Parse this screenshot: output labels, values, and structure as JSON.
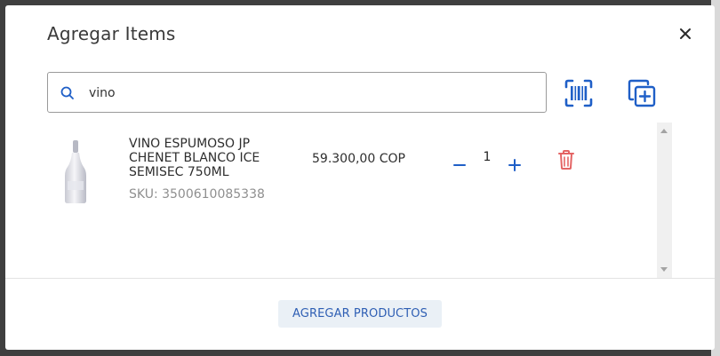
{
  "modal": {
    "title": "Agregar Items",
    "close_icon": "close-icon"
  },
  "search": {
    "value": "vino",
    "icon": "search-icon"
  },
  "toolbar": {
    "barcode_icon": "barcode-scan-icon",
    "add_copy_icon": "add-copy-icon"
  },
  "colors": {
    "accent": "#1f5fc7",
    "danger": "#e46464",
    "button_bg": "#eaf0f6"
  },
  "items": [
    {
      "name": "VINO ESPUMOSO JP CHENET BLANCO ICE SEMISEC 750ML",
      "sku": "SKU: 3500610085338",
      "price": "59.300,00 COP",
      "quantity": "1"
    }
  ],
  "footer": {
    "add_button": "AGREGAR PRODUCTOS"
  }
}
